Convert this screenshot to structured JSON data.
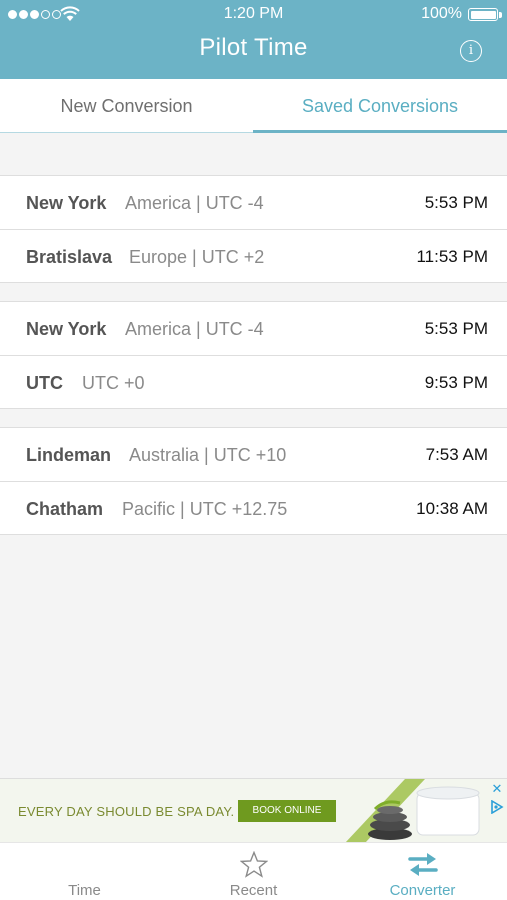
{
  "status_bar": {
    "time": "1:20 PM",
    "battery": "100%",
    "signal_dots": 5,
    "signal_filled": 3
  },
  "nav": {
    "title": "Pilot Time",
    "info_icon": "info-icon"
  },
  "segments": [
    {
      "label": "New Conversion",
      "selected": false
    },
    {
      "label": "Saved Conversions",
      "selected": true
    }
  ],
  "conversions": [
    [
      {
        "city": "New York",
        "region": "America | UTC -4",
        "time": "5:53 PM"
      },
      {
        "city": "Bratislava",
        "region": "Europe | UTC +2",
        "time": "11:53 PM"
      }
    ],
    [
      {
        "city": "New York",
        "region": "America | UTC -4",
        "time": "5:53 PM"
      },
      {
        "city": "UTC",
        "region": "UTC +0",
        "time": "9:53 PM"
      }
    ],
    [
      {
        "city": "Lindeman",
        "region": "Australia | UTC +10",
        "time": "7:53 AM"
      },
      {
        "city": "Chatham",
        "region": "Pacific | UTC +12.75",
        "time": "10:38 AM"
      }
    ]
  ],
  "ad": {
    "headline": "EVERY DAY SHOULD BE SPA DAY.",
    "cta": "BOOK ONLINE",
    "close_icon": "close-icon",
    "adchoices_icon": "adchoices-icon"
  },
  "tab_bar": [
    {
      "label": "Time",
      "icon": "clock-icon",
      "active": false
    },
    {
      "label": "Recent",
      "icon": "star-icon",
      "active": false
    },
    {
      "label": "Converter",
      "icon": "swap-arrows-icon",
      "active": true
    }
  ],
  "colors": {
    "accent": "#6cb3c6",
    "accent_text": "#5aaec2",
    "background": "#f4f4f4",
    "ad_button": "#6f9a1f"
  }
}
